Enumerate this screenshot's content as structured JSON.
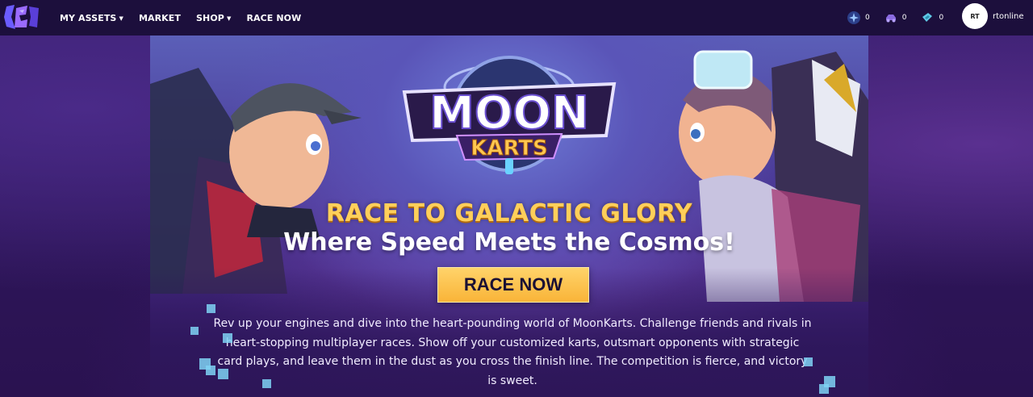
{
  "nav": {
    "links": [
      {
        "label": "MY ASSETS",
        "dropdown": true
      },
      {
        "label": "MARKET",
        "dropdown": false
      },
      {
        "label": "SHOP",
        "dropdown": true
      },
      {
        "label": "RACE NOW",
        "dropdown": false
      }
    ],
    "balances": [
      {
        "icon": "star-coin-icon",
        "value": "0",
        "color": "#4a7ee0"
      },
      {
        "icon": "kart-icon",
        "value": "0",
        "color": "#7a58c8"
      },
      {
        "icon": "ticket-icon",
        "value": "0",
        "color": "#4fb8d8"
      }
    ],
    "user": {
      "initials": "RT",
      "name": "rtonline"
    }
  },
  "hero": {
    "logo_text_top": "MOON",
    "logo_text_bottom": "KARTS",
    "tagline": "RACE TO GALACTIC GLORY",
    "subtitle": "Where Speed Meets the Cosmos!",
    "cta_label": "RACE NOW",
    "description": "Rev up your engines and dive into the heart-pounding world of MoonKarts. Challenge friends and rivals in heart-stopping multiplayer races. Show off your customized karts, outsmart opponents with strategic card plays, and leave them in the dust as you cross the finish line. The competition is fierce, and victory is sweet."
  },
  "colors": {
    "nav_bg": "#1c0f3c",
    "accent_gold": "#ffcf5a",
    "cta_bg": "#f9b438"
  }
}
